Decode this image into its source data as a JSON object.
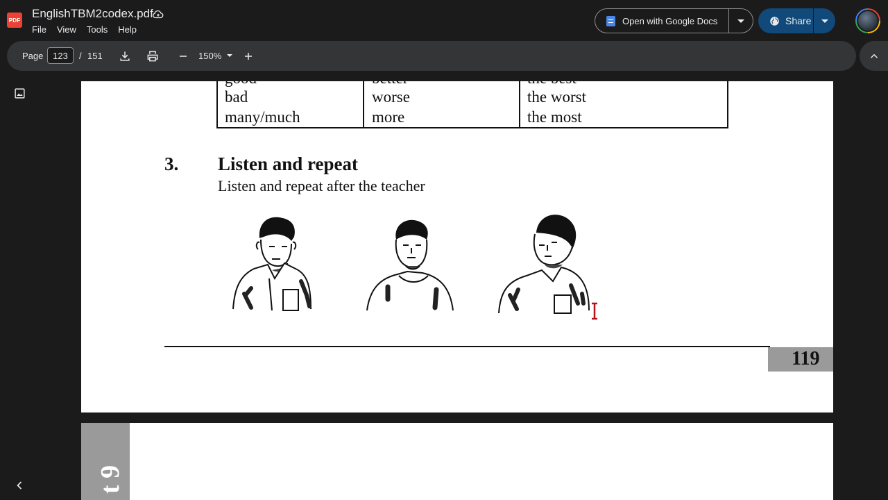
{
  "header": {
    "title": "EnglishTBM2codex.pdf",
    "badge": "PDF",
    "menu": [
      "File",
      "View",
      "Tools",
      "Help"
    ],
    "open_with": "Open with Google Docs",
    "share": "Share"
  },
  "toolbar": {
    "page_label": "Page",
    "current_page": "123",
    "separator": "/",
    "total_pages": "151",
    "zoom": "150%"
  },
  "document": {
    "table_rows": [
      [
        "good",
        "better",
        "the best"
      ],
      [
        "bad",
        "worse",
        "the worst"
      ],
      [
        "many/much",
        "more",
        "the most"
      ]
    ],
    "section_number": "3.",
    "section_title": "Listen and repeat",
    "section_instruction": "Listen and repeat after the teacher",
    "page_number": "119",
    "next_page_unit": "t 9"
  },
  "colors": {
    "background": "#1b1b1b",
    "toolbar": "#333537",
    "share_button": "#114a7a",
    "pdf_badge": "#ea4335",
    "cursor": "#b3121b"
  }
}
